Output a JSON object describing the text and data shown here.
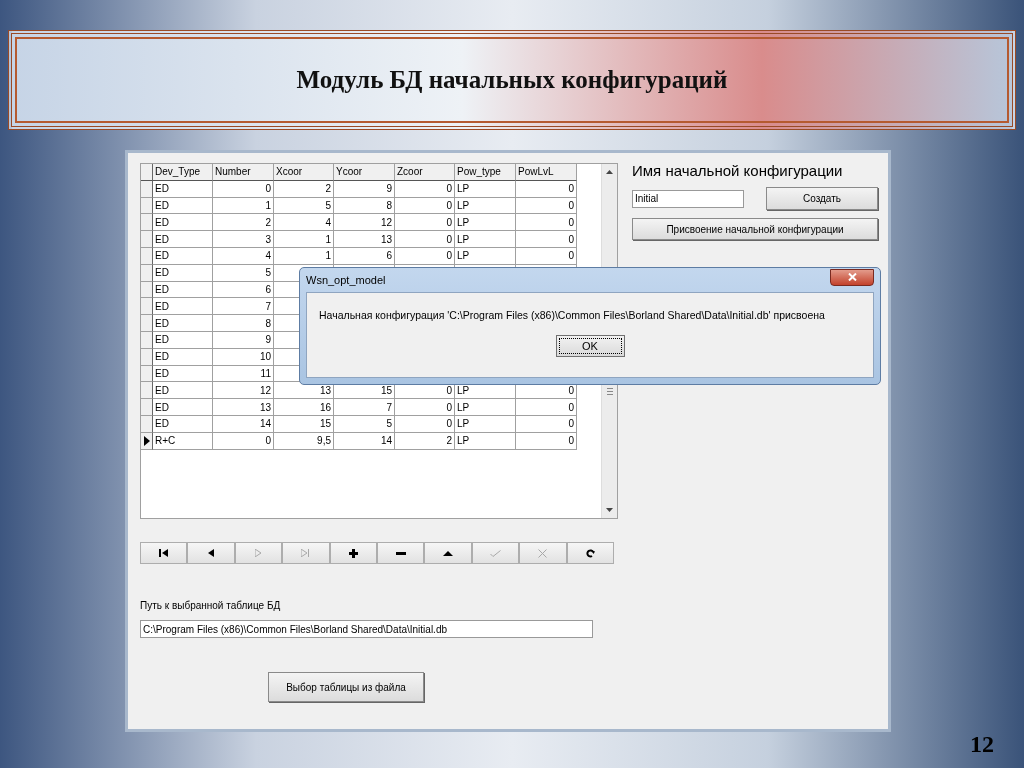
{
  "slide": {
    "title": "Модуль БД начальных конфигураций",
    "page_number": "12"
  },
  "grid": {
    "columns": [
      {
        "label": "Dev_Type",
        "kind": "text"
      },
      {
        "label": "Number",
        "kind": "number"
      },
      {
        "label": "Xcoor",
        "kind": "number"
      },
      {
        "label": "Ycoor",
        "kind": "number"
      },
      {
        "label": "Zcoor",
        "kind": "number"
      },
      {
        "label": "Pow_type",
        "kind": "text"
      },
      {
        "label": "PowLvL",
        "kind": "number"
      }
    ],
    "rows": [
      {
        "selected": false,
        "cells": [
          "ED",
          "0",
          "2",
          "9",
          "0",
          "LP",
          "0"
        ]
      },
      {
        "selected": false,
        "cells": [
          "ED",
          "1",
          "5",
          "8",
          "0",
          "LP",
          "0"
        ]
      },
      {
        "selected": false,
        "cells": [
          "ED",
          "2",
          "4",
          "12",
          "0",
          "LP",
          "0"
        ]
      },
      {
        "selected": false,
        "cells": [
          "ED",
          "3",
          "1",
          "13",
          "0",
          "LP",
          "0"
        ]
      },
      {
        "selected": false,
        "cells": [
          "ED",
          "4",
          "1",
          "6",
          "0",
          "LP",
          "0"
        ]
      },
      {
        "selected": false,
        "cells": [
          "ED",
          "5"
        ]
      },
      {
        "selected": false,
        "cells": [
          "ED",
          "6"
        ]
      },
      {
        "selected": false,
        "cells": [
          "ED",
          "7"
        ]
      },
      {
        "selected": false,
        "cells": [
          "ED",
          "8"
        ]
      },
      {
        "selected": false,
        "cells": [
          "ED",
          "9"
        ]
      },
      {
        "selected": false,
        "cells": [
          "ED",
          "10"
        ]
      },
      {
        "selected": false,
        "cells": [
          "ED",
          "11"
        ]
      },
      {
        "selected": false,
        "cells": [
          "ED",
          "12",
          "13",
          "15",
          "0",
          "LP",
          "0"
        ]
      },
      {
        "selected": false,
        "cells": [
          "ED",
          "13",
          "16",
          "7",
          "0",
          "LP",
          "0"
        ]
      },
      {
        "selected": false,
        "cells": [
          "ED",
          "14",
          "15",
          "5",
          "0",
          "LP",
          "0"
        ]
      },
      {
        "selected": true,
        "cells": [
          "R+C",
          "0",
          "9,5",
          "14",
          "2",
          "LP",
          "0"
        ]
      }
    ]
  },
  "navigator": [
    {
      "kind": "first",
      "disabled": false
    },
    {
      "kind": "prior",
      "disabled": false
    },
    {
      "kind": "next",
      "disabled": true
    },
    {
      "kind": "last",
      "disabled": true
    },
    {
      "kind": "insert",
      "disabled": false
    },
    {
      "kind": "delete",
      "disabled": false
    },
    {
      "kind": "edit",
      "disabled": false
    },
    {
      "kind": "post",
      "disabled": true
    },
    {
      "kind": "cancel",
      "disabled": true
    },
    {
      "kind": "refresh",
      "disabled": false
    }
  ],
  "path_label": "Путь к  выбранной таблице БД",
  "path_field": {
    "value": "C:\\Program Files (x86)\\Common Files\\Borland Shared\\Data\\Initial.db"
  },
  "choose_button": "Выбор таблицы из файла",
  "config": {
    "heading": "Имя начальной конфигурации",
    "name_field": {
      "value": "Initial"
    },
    "create_button": "Создать",
    "assign_button": "Присвоение начальной конфигурации"
  },
  "dialog": {
    "title": "Wsn_opt_model",
    "message": "Начальная конфигурация 'C:\\Program Files (x86)\\Common Files\\Borland Shared\\Data\\Initial.db'  присвоена",
    "ok_button": "OK"
  }
}
